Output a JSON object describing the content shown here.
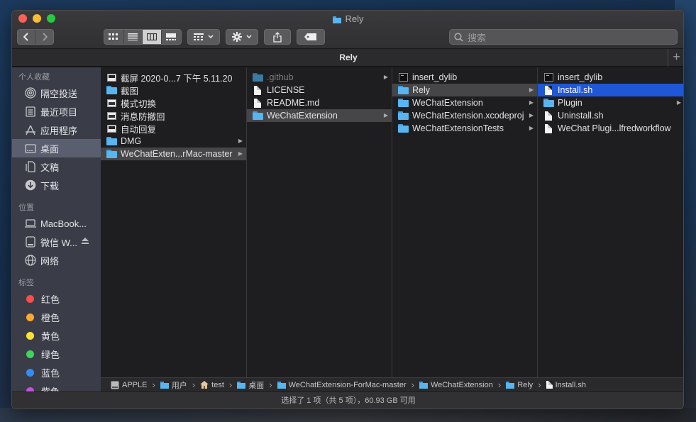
{
  "window": {
    "title": "Rely"
  },
  "toolbar": {
    "search_placeholder": "搜索"
  },
  "tab": {
    "label": "Rely",
    "add_symbol": "+"
  },
  "sidebar": {
    "sections": [
      {
        "label": "个人收藏",
        "items": [
          {
            "label": "隔空投送",
            "icon": "airdrop-icon"
          },
          {
            "label": "最近项目",
            "icon": "recents-icon"
          },
          {
            "label": "应用程序",
            "icon": "applications-icon"
          },
          {
            "label": "桌面",
            "icon": "desktop-icon",
            "selected": true
          },
          {
            "label": "文稿",
            "icon": "documents-icon"
          },
          {
            "label": "下载",
            "icon": "downloads-icon"
          }
        ]
      },
      {
        "label": "位置",
        "items": [
          {
            "label": "MacBook...",
            "icon": "laptop-icon"
          },
          {
            "label": "微信 W...",
            "icon": "disk-icon",
            "eject": true
          },
          {
            "label": "网络",
            "icon": "network-icon"
          }
        ]
      },
      {
        "label": "标签",
        "tags": [
          {
            "label": "红色",
            "color": "#fe4b4b"
          },
          {
            "label": "橙色",
            "color": "#fca92f"
          },
          {
            "label": "黄色",
            "color": "#fde235"
          },
          {
            "label": "绿色",
            "color": "#3cd65a"
          },
          {
            "label": "蓝色",
            "color": "#2f8ef6"
          },
          {
            "label": "紫色",
            "color": "#c94fe0"
          }
        ]
      }
    ]
  },
  "columns": [
    {
      "items": [
        {
          "label": "截屏 2020-0...7 下午 5.11.20",
          "icon": "image-file-icon",
          "arrow": false
        },
        {
          "label": "截图",
          "icon": "folder-icon",
          "arrow": false
        },
        {
          "label": "模式切换",
          "icon": "app-file-icon",
          "arrow": false
        },
        {
          "label": "消息防撤回",
          "icon": "app-file-icon",
          "arrow": false
        },
        {
          "label": "自动回复",
          "icon": "image-file-icon",
          "arrow": false
        },
        {
          "label": "DMG",
          "icon": "folder-icon",
          "arrow": true
        },
        {
          "label": "WeChatExten...rMac-master",
          "icon": "folder-icon",
          "arrow": true,
          "selected": "grey"
        }
      ]
    },
    {
      "items": [
        {
          "label": ".github",
          "icon": "folder-icon",
          "arrow": true,
          "dim": true
        },
        {
          "label": "LICENSE",
          "icon": "document-icon",
          "arrow": false
        },
        {
          "label": "README.md",
          "icon": "document-icon",
          "arrow": false
        },
        {
          "label": "WeChatExtension",
          "icon": "folder-icon",
          "arrow": true,
          "selected": "grey"
        }
      ]
    },
    {
      "items": [
        {
          "label": "insert_dylib",
          "icon": "executable-icon",
          "arrow": false
        },
        {
          "label": "Rely",
          "icon": "folder-icon",
          "arrow": true,
          "selected": "grey"
        },
        {
          "label": "WeChatExtension",
          "icon": "folder-icon",
          "arrow": true
        },
        {
          "label": "WeChatExtension.xcodeproj",
          "icon": "folder-icon",
          "arrow": true
        },
        {
          "label": "WeChatExtensionTests",
          "icon": "folder-icon",
          "arrow": true
        }
      ]
    },
    {
      "items": [
        {
          "label": "insert_dylib",
          "icon": "executable-icon",
          "arrow": false
        },
        {
          "label": "Install.sh",
          "icon": "document-icon",
          "arrow": false,
          "selected": "blue"
        },
        {
          "label": "Plugin",
          "icon": "folder-icon",
          "arrow": true
        },
        {
          "label": "Uninstall.sh",
          "icon": "document-icon",
          "arrow": false
        },
        {
          "label": "WeChat Plugi...lfredworkflow",
          "icon": "document-icon",
          "arrow": false
        }
      ]
    }
  ],
  "pathbar": [
    {
      "label": "APPLE",
      "icon": "disk-icon"
    },
    {
      "label": "用户",
      "icon": "folder-icon"
    },
    {
      "label": "test",
      "icon": "home-icon"
    },
    {
      "label": "桌面",
      "icon": "folder-icon"
    },
    {
      "label": "WeChatExtension-ForMac-master",
      "icon": "folder-icon"
    },
    {
      "label": "WeChatExtension",
      "icon": "folder-icon"
    },
    {
      "label": "Rely",
      "icon": "folder-icon"
    },
    {
      "label": "Install.sh",
      "icon": "document-icon"
    }
  ],
  "status": {
    "text": "选择了 1 项（共 5 项），60.93 GB 可用"
  }
}
